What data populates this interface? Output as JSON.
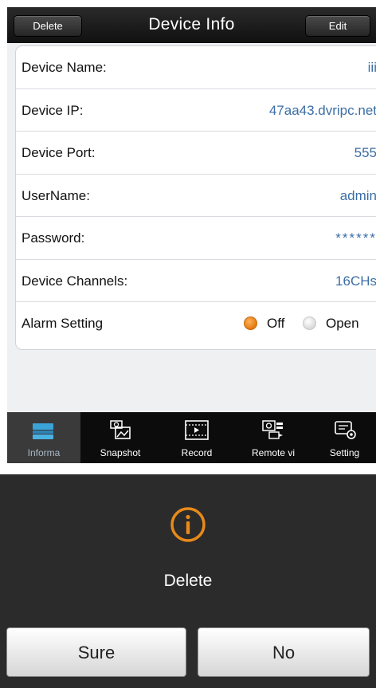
{
  "header": {
    "title": "Device Info",
    "delete_label": "Delete",
    "edit_label": "Edit"
  },
  "device_info": {
    "rows": [
      {
        "label": "Device Name:",
        "value": "iii"
      },
      {
        "label": "Device IP:",
        "value": "47aa43.dvripc.net"
      },
      {
        "label": "Device Port:",
        "value": "555"
      },
      {
        "label": "UserName:",
        "value": "admin"
      },
      {
        "label": "Password:",
        "value": "******"
      },
      {
        "label": "Device Channels:",
        "value": "16CHs"
      }
    ],
    "alarm": {
      "label": "Alarm Setting",
      "options": [
        {
          "label": "Off",
          "selected": true
        },
        {
          "label": "Open",
          "selected": false
        }
      ]
    }
  },
  "tabbar": {
    "tabs": [
      {
        "label": "Informa",
        "icon": "information-icon",
        "active": true
      },
      {
        "label": "Snapshot",
        "icon": "snapshot-icon",
        "active": false
      },
      {
        "label": "Record",
        "icon": "record-icon",
        "active": false
      },
      {
        "label": "Remote vi",
        "icon": "remote-view-icon",
        "active": false
      },
      {
        "label": "Setting",
        "icon": "setting-icon",
        "active": false
      }
    ]
  },
  "dialog": {
    "icon": "info-icon",
    "title": "Delete",
    "confirm_label": "Sure",
    "cancel_label": "No"
  },
  "colors": {
    "accent_orange": "#e88a1a",
    "value_blue": "#3b6ea5",
    "nav_dark": "#1a1a1a"
  }
}
